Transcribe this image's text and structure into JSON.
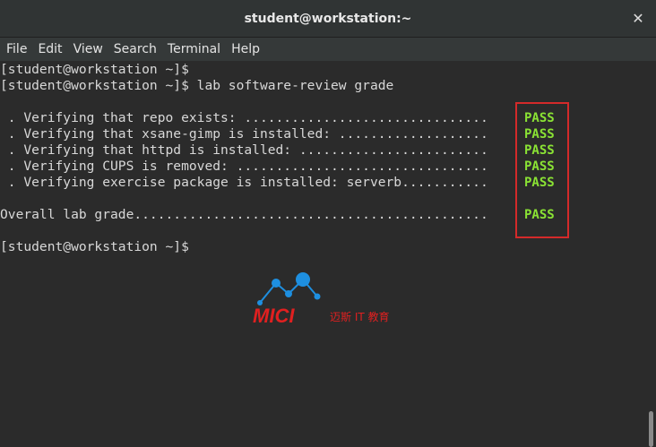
{
  "window": {
    "title": "student@workstation:~",
    "close_glyph": "✕"
  },
  "menu": {
    "items": [
      "File",
      "Edit",
      "View",
      "Search",
      "Terminal",
      "Help"
    ]
  },
  "terminal": {
    "lines": [
      "[student@workstation ~]$",
      "[student@workstation ~]$ lab software-review grade",
      "",
      " . Verifying that repo exists: ...............................",
      " . Verifying that xsane-gimp is installed: ...................",
      " . Verifying that httpd is installed: ........................",
      " . Verifying CUPS is removed: ................................",
      " . Verifying exercise package is installed: serverb...........",
      "",
      "Overall lab grade.............................................",
      "",
      "[student@workstation ~]$"
    ],
    "results": [
      "PASS",
      "PASS",
      "PASS",
      "PASS",
      "PASS",
      "PASS"
    ]
  },
  "watermark": {
    "brand": "MICI",
    "tagline": "迈斯 IT 教育"
  },
  "colors": {
    "pass": "#8ae234",
    "highlight_border": "#d42a2a",
    "logo_blue": "#1e8fe0",
    "logo_red": "#e02020"
  }
}
